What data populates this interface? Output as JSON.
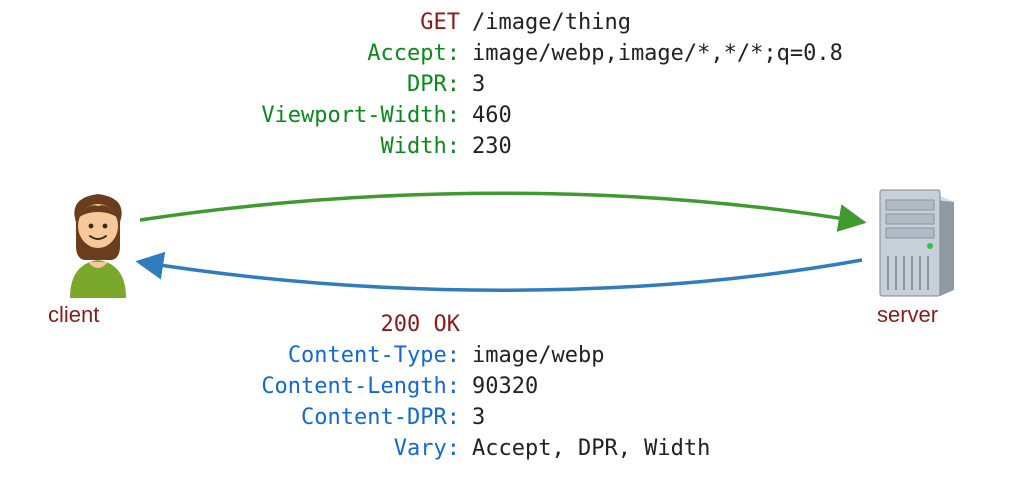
{
  "labels": {
    "client": "client",
    "server": "server"
  },
  "request": {
    "method": "GET",
    "path": "/image/thing",
    "headers": [
      {
        "name": "Accept:",
        "value": "image/webp,image/*,*/*;q=0.8"
      },
      {
        "name": "DPR:",
        "value": "3"
      },
      {
        "name": "Viewport-Width:",
        "value": "460"
      },
      {
        "name": "Width:",
        "value": "230"
      }
    ]
  },
  "response": {
    "status": "200 OK",
    "headers": [
      {
        "name": "Content-Type:",
        "value": "image/webp"
      },
      {
        "name": "Content-Length:",
        "value": "90320"
      },
      {
        "name": "Content-DPR:",
        "value": "3"
      },
      {
        "name": "Vary:",
        "value": "Accept, DPR, Width"
      }
    ]
  },
  "colors": {
    "request_header": "#0a8a1a",
    "response_header": "#1268d8",
    "emph": "#8b1a1a",
    "value": "#222222",
    "arrow_request": "#3f9b2f",
    "arrow_response": "#2f7cbf"
  }
}
